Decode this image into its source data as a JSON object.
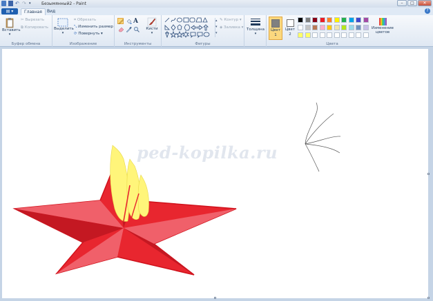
{
  "window": {
    "title": "Безымянный2 - Paint"
  },
  "tabs": {
    "home": "Главная",
    "view": "Вид"
  },
  "clipboard": {
    "paste": "Вставить",
    "cut": "Вырезать",
    "copy": "Копировать",
    "group_label": "Буфер обмена"
  },
  "image": {
    "select": "Выделить",
    "crop": "Обрезать",
    "resize": "Изменить размер",
    "rotate": "Повернуть",
    "group_label": "Изображение"
  },
  "tools": {
    "group_label": "Инструменты",
    "brushes": "Кисти"
  },
  "shapes": {
    "outline": "Контур",
    "fill": "Заливка",
    "group_label": "Фигуры"
  },
  "size": {
    "label": "Толщина"
  },
  "colors": {
    "color1_label": "Цвет 1",
    "color2_label": "Цвет 2",
    "edit_label": "Изменение цветов",
    "group_label": "Цвета",
    "color1": "#808080",
    "color2": "#ffffff",
    "palette": [
      "#000000",
      "#7f7f7f",
      "#880015",
      "#ed1c24",
      "#ff7f27",
      "#fff200",
      "#22b14c",
      "#00a2e8",
      "#3f48cc",
      "#a349a4",
      "#ffffff",
      "#c3c3c3",
      "#b97a57",
      "#ffaec9",
      "#ffc90e",
      "#efe4b0",
      "#b5e61d",
      "#99d9ea",
      "#7092be",
      "#c8bfe7",
      "#ffff66",
      "#ffff66",
      "#ffffff",
      "#ffffff",
      "#ffffff",
      "#ffffff",
      "#ffffff",
      "#ffffff",
      "#ffffff",
      "#ffffff"
    ]
  },
  "canvas": {
    "watermark": "ped-kopilka.ru"
  }
}
